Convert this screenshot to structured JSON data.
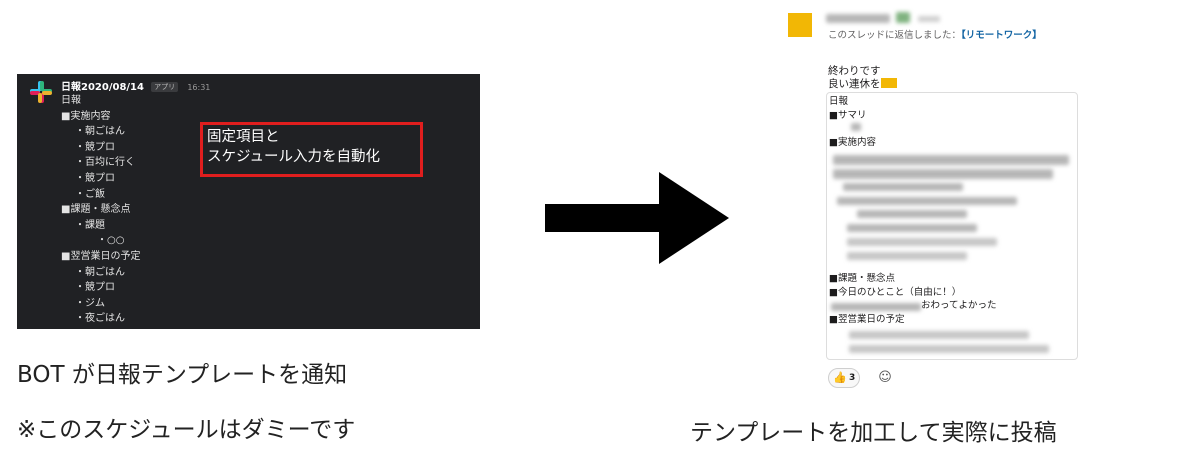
{
  "left": {
    "message": {
      "title": "日報2020/08/14",
      "app_badge": "アプリ",
      "time": "16:31",
      "lines": [
        "日報",
        "■実施内容",
        "・朝ごはん",
        "・競プロ",
        "・百均に行く",
        "・競プロ",
        "・ご飯",
        "■課題・懸念点",
        "・課題",
        "・○○",
        "■翌営業日の予定",
        "・朝ごはん",
        "・競プロ",
        "・ジム",
        "・夜ごはん"
      ]
    },
    "highlight": {
      "line1": "固定項目と",
      "line2": "スケジュール入力を自動化",
      "color": "#e01e1e"
    },
    "caption1": "BOT が日報テンプレートを通知",
    "caption2": "※このスケジュールはダミーです",
    "panel_bg": "#202124"
  },
  "right": {
    "reply_note_prefix": "このスレッドに返信しました：",
    "reply_note_link": "【リモートワーク】",
    "body_line1": "終わりです",
    "body_line2": "良い連休を",
    "template": {
      "title": "日報",
      "summary": "■サマリ",
      "work": "■実施内容",
      "issues": "■課題・懸念点",
      "today_word": "■今日のひとこと（自由に！）",
      "today_word_tail": "おわってよかった",
      "next_day": "■翌営業日の予定"
    },
    "reaction_count": "3",
    "caption": "テンプレートを加工して実際に投稿",
    "avatar_color": "#f2b705",
    "link_color": "#1264a3"
  },
  "arrow_icon": "right-arrow-icon"
}
